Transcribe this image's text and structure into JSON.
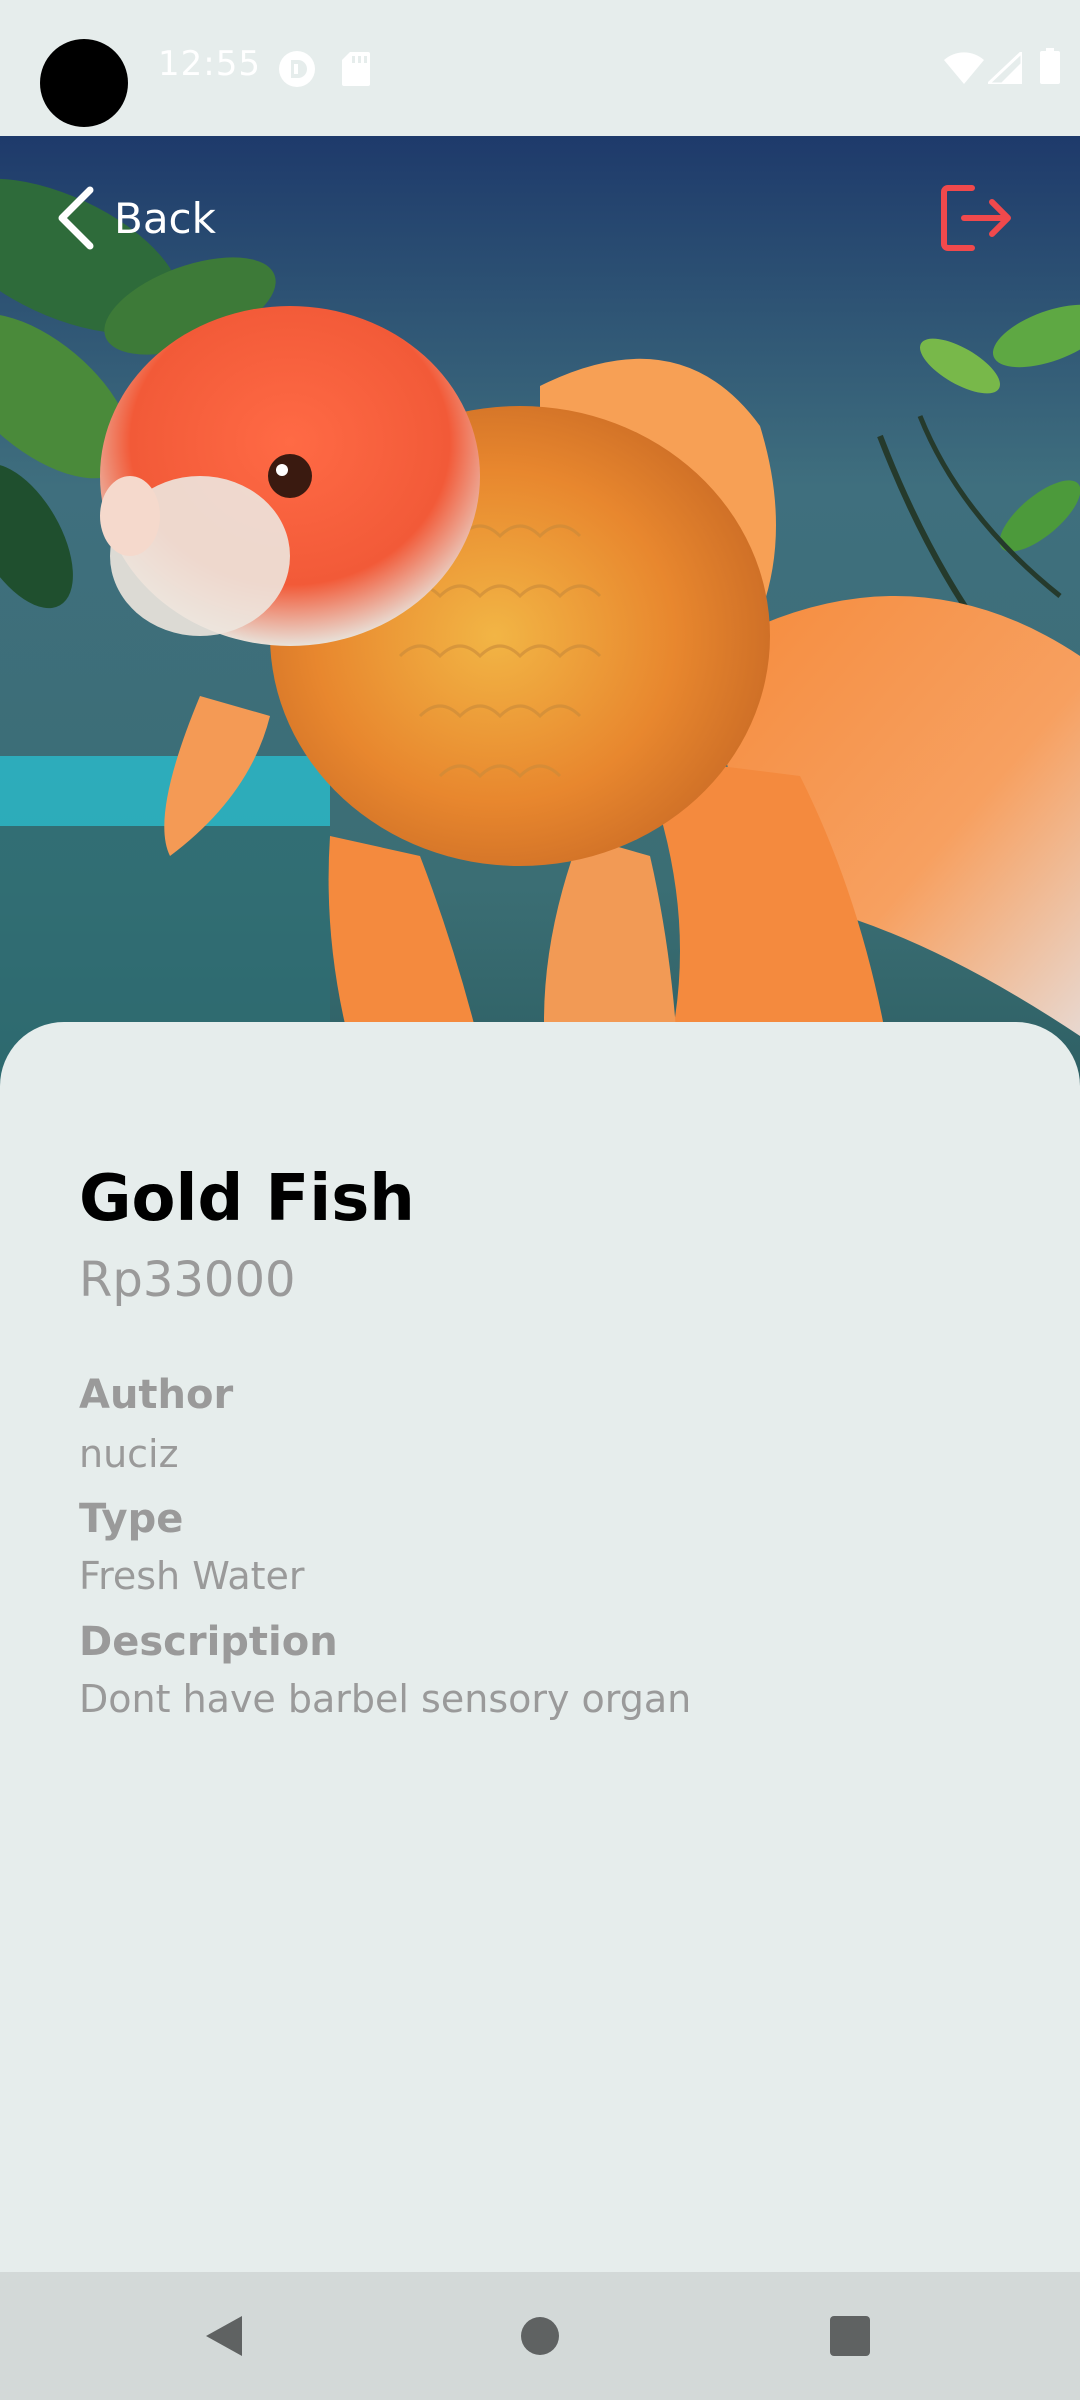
{
  "status_bar": {
    "time": "12:55",
    "icons": [
      "camera-cutout",
      "vpn-key-icon",
      "sd-card-icon",
      "wifi-icon",
      "signal-icon",
      "battery-icon"
    ]
  },
  "header": {
    "back_label": "Back",
    "logout_icon": "logout-icon",
    "logout_color": "#F0494C"
  },
  "product": {
    "name": "Gold Fish",
    "price": "Rp33000",
    "author_label": "Author",
    "author": "nuciz",
    "type_label": "Type",
    "type": "Fresh Water",
    "description_label": "Description",
    "description": "Dont have barbel sensory organ"
  },
  "navigation": {
    "buttons": [
      "back-triangle-icon",
      "home-circle-icon",
      "recents-square-icon"
    ]
  },
  "colors": {
    "background": "#E6EDEC",
    "title": "#000000",
    "muted_text": "#9A9A9A",
    "nav_bar": "#D3D9D8"
  }
}
